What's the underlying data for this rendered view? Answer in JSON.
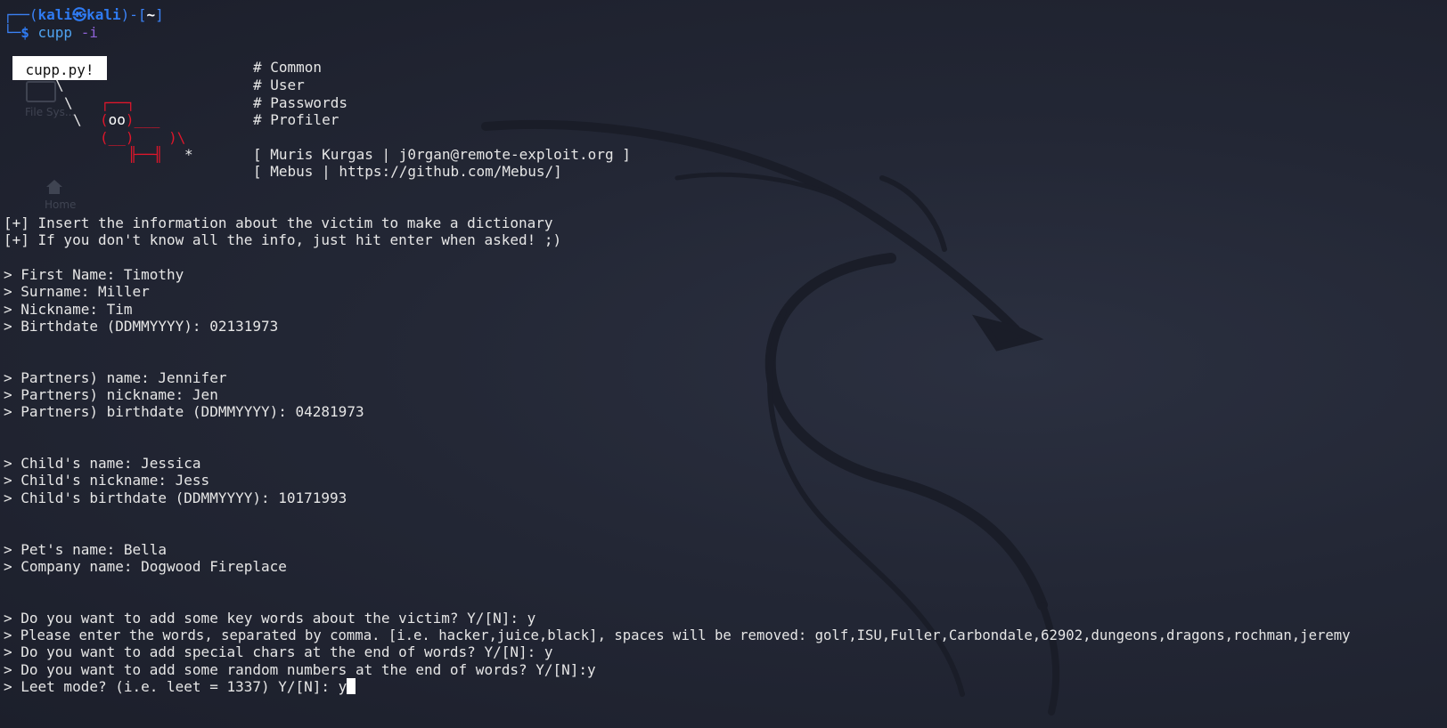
{
  "desktop": {
    "icons": [
      {
        "name": "file-system-icon",
        "label": "File Sys..."
      },
      {
        "name": "home-icon",
        "label": "Home"
      }
    ]
  },
  "prompt": {
    "user": "kali",
    "host": "kali",
    "dir": "~",
    "command": "cupp",
    "flag": "-i"
  },
  "banner": {
    "badge": "cupp.py!",
    "lines": [
      "# Common",
      "# User",
      "# Passwords",
      "# Profiler"
    ],
    "credits": [
      "[ Muris Kurgas | j0rgan@remote-exploit.org ]",
      "[ Mebus | https://github.com/Mebus/]"
    ]
  },
  "info": [
    "[+] Insert the information about the victim to make a dictionary",
    "[+] If you don't know all the info, just hit enter when asked! ;)"
  ],
  "answers": {
    "first_name": "> First Name: Timothy",
    "surname": "> Surname: Miller",
    "nickname": "> Nickname: Tim",
    "birthdate": "> Birthdate (DDMMYYYY): 02131973",
    "partner_name": "> Partners) name: Jennifer",
    "partner_nickname": "> Partners) nickname: Jen",
    "partner_birthdate": "> Partners) birthdate (DDMMYYYY): 04281973",
    "child_name": "> Child's name: Jessica",
    "child_nickname": "> Child's nickname: Jess",
    "child_birthdate": "> Child's birthdate (DDMMYYYY): 10171993",
    "pet_name": "> Pet's name: Bella",
    "company_name": "> Company name: Dogwood Fireplace",
    "keywords_q": "> Do you want to add some key words about the victim? Y/[N]: y",
    "keywords": "> Please enter the words, separated by comma. [i.e. hacker,juice,black], spaces will be removed: golf,ISU,Fuller,Carbondale,62902,dungeons,dragons,rochman,jeremy",
    "special_chars": "> Do you want to add special chars at the end of words? Y/[N]: y",
    "random_numbers": "> Do you want to add some random numbers at the end of words? Y/[N]:y",
    "leet_mode": "> Leet mode? (i.e. leet = 1337) Y/[N]: y"
  },
  "colors": {
    "background": "#232735",
    "prompt_blue": "#3b82f6",
    "command": "#4fa3f0",
    "flag": "#8e61d6",
    "ascii_red": "#e0162b",
    "text": "#e6e6e6"
  }
}
